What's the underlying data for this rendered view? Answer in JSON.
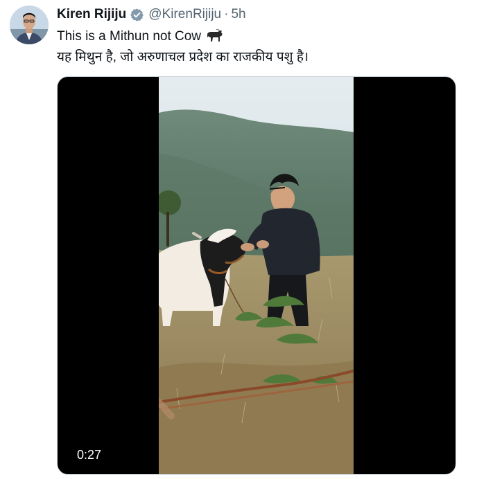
{
  "tweet": {
    "display_name": "Kiren Rijiju",
    "handle": "@KirenRijiju",
    "separator": "·",
    "time": "5h",
    "text_line_1": "This is a Mithun not Cow",
    "text_line_2": "यह मिथुन है, जो अरुणाचल प्रदेश का राजकीय पशु है।",
    "emoji": "ox-emoji"
  },
  "media": {
    "type": "video",
    "duration": "0:27"
  },
  "icons": {
    "verified": "verified-badge-icon",
    "avatar": "profile-avatar"
  },
  "colors": {
    "verified_badge": "#829aab",
    "text": "#0f1419",
    "secondary_text": "#536471"
  }
}
